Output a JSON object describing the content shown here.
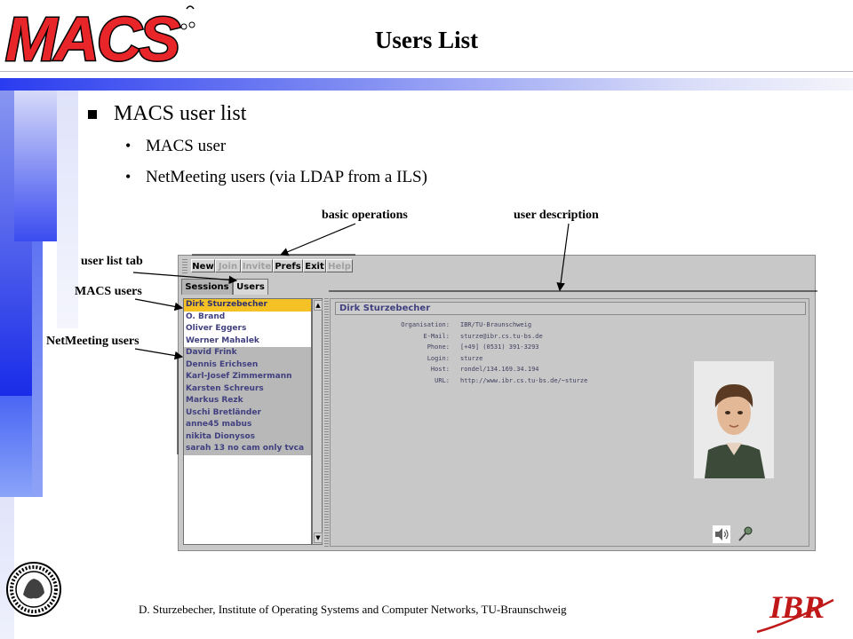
{
  "slide": {
    "title": "Users List",
    "bullets": [
      {
        "level": 1,
        "text": "MACS user list"
      },
      {
        "level": 2,
        "text": "MACS user"
      },
      {
        "level": 2,
        "text": "NetMeeting users (via LDAP from a ILS)"
      }
    ],
    "footer": "D. Sturzebecher, Institute of Operating Systems and Computer Networks, TU-Braunschweig"
  },
  "logos": {
    "macs": "MACS",
    "ibr": "IBR",
    "seal": "CAROLO-WILHELMINA BRAUNSCHWEIG"
  },
  "annotations": {
    "basic_operations": "basic operations",
    "user_description": "user description",
    "user_list_tab": "user list tab",
    "macs_users": "MACS users",
    "netmeeting_users": "NetMeeting users"
  },
  "app": {
    "toolbar": [
      {
        "label": "New",
        "enabled": true
      },
      {
        "label": "Join",
        "enabled": false
      },
      {
        "label": "Invite",
        "enabled": false
      },
      {
        "label": "Prefs",
        "enabled": true
      },
      {
        "label": "Exit",
        "enabled": true
      },
      {
        "label": "Help",
        "enabled": false
      }
    ],
    "tabs": [
      {
        "label": "Sessions",
        "active": false
      },
      {
        "label": "Users",
        "active": true
      }
    ],
    "macs_users": [
      "Dirk Sturzebecher",
      "O. Brand",
      "Oliver Eggers",
      "Werner Mahalek"
    ],
    "netmeeting_users": [
      "David Frink",
      "Dennis Erichsen",
      "Karl-Josef Zimmermann",
      "Karsten Schreurs",
      "Markus Rezk",
      "Uschi Bretländer",
      "anne45 mabus",
      "nikita Dionysos",
      "sarah 13 no cam only tvca"
    ],
    "selected_user": "Dirk Sturzebecher",
    "detail": {
      "name": "Dirk Sturzebecher",
      "fields": [
        {
          "label": "Organisation:",
          "value": "IBR/TU-Braunschweig"
        },
        {
          "label": "E-Mail:",
          "value": "sturze@ibr.cs.tu-bs.de"
        },
        {
          "label": "Phone:",
          "value": "[+49] (0531) 391-3293"
        },
        {
          "label": "Login:",
          "value": "sturze"
        },
        {
          "label": "Host:",
          "value": "rondel/134.169.34.194"
        },
        {
          "label": "URL:",
          "value": "http://www.ibr.cs.tu-bs.de/~sturze"
        }
      ]
    },
    "icons": [
      "speaker-icon",
      "microphone-icon"
    ]
  },
  "colors": {
    "selection": "#f4c224",
    "macs_logo": "#e8262a",
    "accent_blue": "#2a3cf0"
  }
}
